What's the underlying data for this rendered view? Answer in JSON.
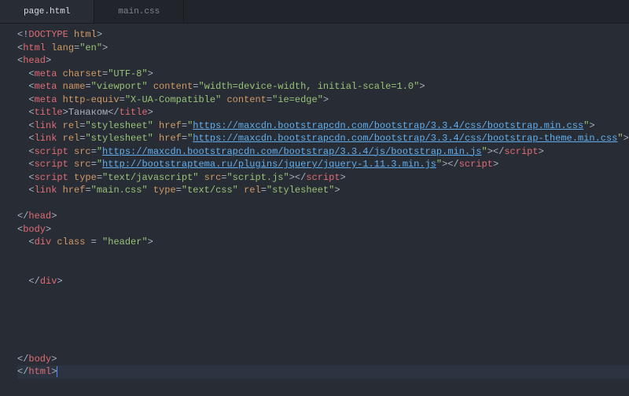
{
  "tabs": [
    {
      "label": "page.html",
      "active": true
    },
    {
      "label": "main.css",
      "active": false
    }
  ],
  "code": {
    "lines": [
      [
        {
          "c": "p",
          "t": "<!"
        },
        {
          "c": "t",
          "t": "DOCTYPE"
        },
        {
          "c": "a",
          "t": " html"
        },
        {
          "c": "p",
          "t": ">"
        }
      ],
      [
        {
          "c": "p",
          "t": "<"
        },
        {
          "c": "t",
          "t": "html"
        },
        {
          "c": "a",
          "t": " lang"
        },
        {
          "c": "p",
          "t": "="
        },
        {
          "c": "s",
          "t": "\"en\""
        },
        {
          "c": "p",
          "t": ">"
        }
      ],
      [
        {
          "c": "p",
          "t": "<"
        },
        {
          "c": "t",
          "t": "head"
        },
        {
          "c": "p",
          "t": ">"
        }
      ],
      [
        {
          "c": "p",
          "t": "  <"
        },
        {
          "c": "t",
          "t": "meta"
        },
        {
          "c": "a",
          "t": " charset"
        },
        {
          "c": "p",
          "t": "="
        },
        {
          "c": "s",
          "t": "\"UTF-8\""
        },
        {
          "c": "p",
          "t": ">"
        }
      ],
      [
        {
          "c": "p",
          "t": "  <"
        },
        {
          "c": "t",
          "t": "meta"
        },
        {
          "c": "a",
          "t": " name"
        },
        {
          "c": "p",
          "t": "="
        },
        {
          "c": "s",
          "t": "\"viewport\""
        },
        {
          "c": "a",
          "t": " content"
        },
        {
          "c": "p",
          "t": "="
        },
        {
          "c": "s",
          "t": "\"width=device-width, initial-scale=1.0\""
        },
        {
          "c": "p",
          "t": ">"
        }
      ],
      [
        {
          "c": "p",
          "t": "  <"
        },
        {
          "c": "t",
          "t": "meta"
        },
        {
          "c": "a",
          "t": " http-equiv"
        },
        {
          "c": "p",
          "t": "="
        },
        {
          "c": "s",
          "t": "\"X-UA-Compatible\""
        },
        {
          "c": "a",
          "t": " content"
        },
        {
          "c": "p",
          "t": "="
        },
        {
          "c": "s",
          "t": "\"ie=edge\""
        },
        {
          "c": "p",
          "t": ">"
        }
      ],
      [
        {
          "c": "p",
          "t": "  <"
        },
        {
          "c": "t",
          "t": "title"
        },
        {
          "c": "p",
          "t": ">Танаком</"
        },
        {
          "c": "t",
          "t": "title"
        },
        {
          "c": "p",
          "t": ">"
        }
      ],
      [
        {
          "c": "p",
          "t": "  <"
        },
        {
          "c": "t",
          "t": "link"
        },
        {
          "c": "a",
          "t": " rel"
        },
        {
          "c": "p",
          "t": "="
        },
        {
          "c": "s",
          "t": "\"stylesheet\""
        },
        {
          "c": "a",
          "t": " href"
        },
        {
          "c": "p",
          "t": "="
        },
        {
          "c": "s",
          "t": "\""
        },
        {
          "c": "u",
          "t": "https://maxcdn.bootstrapcdn.com/bootstrap/3.3.4/css/bootstrap.min.css"
        },
        {
          "c": "s",
          "t": "\""
        },
        {
          "c": "p",
          "t": ">"
        }
      ],
      [
        {
          "c": "p",
          "t": "  <"
        },
        {
          "c": "t",
          "t": "link"
        },
        {
          "c": "a",
          "t": " rel"
        },
        {
          "c": "p",
          "t": "="
        },
        {
          "c": "s",
          "t": "\"stylesheet\""
        },
        {
          "c": "a",
          "t": " href"
        },
        {
          "c": "p",
          "t": "="
        },
        {
          "c": "s",
          "t": "\""
        },
        {
          "c": "u",
          "t": "https://maxcdn.bootstrapcdn.com/bootstrap/3.3.4/css/bootstrap-theme.min.css"
        },
        {
          "c": "s",
          "t": "\""
        },
        {
          "c": "p",
          "t": ">"
        }
      ],
      [
        {
          "c": "p",
          "t": "  <"
        },
        {
          "c": "t",
          "t": "script"
        },
        {
          "c": "a",
          "t": " src"
        },
        {
          "c": "p",
          "t": "="
        },
        {
          "c": "s",
          "t": "\""
        },
        {
          "c": "u",
          "t": "https://maxcdn.bootstrapcdn.com/bootstrap/3.3.4/js/bootstrap.min.js"
        },
        {
          "c": "s",
          "t": "\""
        },
        {
          "c": "p",
          "t": "></"
        },
        {
          "c": "t",
          "t": "script"
        },
        {
          "c": "p",
          "t": ">"
        }
      ],
      [
        {
          "c": "p",
          "t": "  <"
        },
        {
          "c": "t",
          "t": "script"
        },
        {
          "c": "a",
          "t": " src"
        },
        {
          "c": "p",
          "t": "="
        },
        {
          "c": "s",
          "t": "\""
        },
        {
          "c": "u",
          "t": "http://bootstraptema.ru/plugins/jquery/jquery-1.11.3.min.js"
        },
        {
          "c": "s",
          "t": "\""
        },
        {
          "c": "p",
          "t": "></"
        },
        {
          "c": "t",
          "t": "script"
        },
        {
          "c": "p",
          "t": ">"
        }
      ],
      [
        {
          "c": "p",
          "t": "  <"
        },
        {
          "c": "t",
          "t": "script"
        },
        {
          "c": "a",
          "t": " type"
        },
        {
          "c": "p",
          "t": "="
        },
        {
          "c": "s",
          "t": "\"text/javascript\""
        },
        {
          "c": "a",
          "t": " src"
        },
        {
          "c": "p",
          "t": "="
        },
        {
          "c": "s",
          "t": "\"script.js\""
        },
        {
          "c": "p",
          "t": "></"
        },
        {
          "c": "t",
          "t": "script"
        },
        {
          "c": "p",
          "t": ">"
        }
      ],
      [
        {
          "c": "p",
          "t": "  <"
        },
        {
          "c": "t",
          "t": "link"
        },
        {
          "c": "a",
          "t": " href"
        },
        {
          "c": "p",
          "t": "="
        },
        {
          "c": "s",
          "t": "\"main.css\""
        },
        {
          "c": "a",
          "t": " type"
        },
        {
          "c": "p",
          "t": "="
        },
        {
          "c": "s",
          "t": "\"text/css\""
        },
        {
          "c": "a",
          "t": " rel"
        },
        {
          "c": "p",
          "t": "="
        },
        {
          "c": "s",
          "t": "\"stylesheet\""
        },
        {
          "c": "p",
          "t": ">"
        }
      ],
      [
        {
          "c": "p",
          "t": " "
        }
      ],
      [
        {
          "c": "p",
          "t": "</"
        },
        {
          "c": "t",
          "t": "head"
        },
        {
          "c": "p",
          "t": ">"
        }
      ],
      [
        {
          "c": "p",
          "t": "<"
        },
        {
          "c": "t",
          "t": "body"
        },
        {
          "c": "p",
          "t": ">"
        }
      ],
      [
        {
          "c": "p",
          "t": "  <"
        },
        {
          "c": "t",
          "t": "div"
        },
        {
          "c": "a",
          "t": " class"
        },
        {
          "c": "p",
          "t": " = "
        },
        {
          "c": "s",
          "t": "\"header\""
        },
        {
          "c": "p",
          "t": ">"
        }
      ],
      [
        {
          "c": "p",
          "t": " "
        }
      ],
      [
        {
          "c": "p",
          "t": " "
        }
      ],
      [
        {
          "c": "p",
          "t": "  </"
        },
        {
          "c": "t",
          "t": "div"
        },
        {
          "c": "p",
          "t": ">"
        }
      ],
      [
        {
          "c": "p",
          "t": " "
        }
      ],
      [
        {
          "c": "p",
          "t": " "
        }
      ],
      [
        {
          "c": "p",
          "t": " "
        }
      ],
      [
        {
          "c": "p",
          "t": " "
        }
      ],
      [
        {
          "c": "p",
          "t": " "
        }
      ],
      [
        {
          "c": "p",
          "t": "</"
        },
        {
          "c": "t",
          "t": "body"
        },
        {
          "c": "p",
          "t": ">"
        }
      ],
      [
        {
          "c": "p",
          "t": "</"
        },
        {
          "c": "t",
          "t": "html"
        },
        {
          "c": "p",
          "t": ">"
        }
      ]
    ],
    "cursor_line": 26,
    "highlight_line": 26
  }
}
